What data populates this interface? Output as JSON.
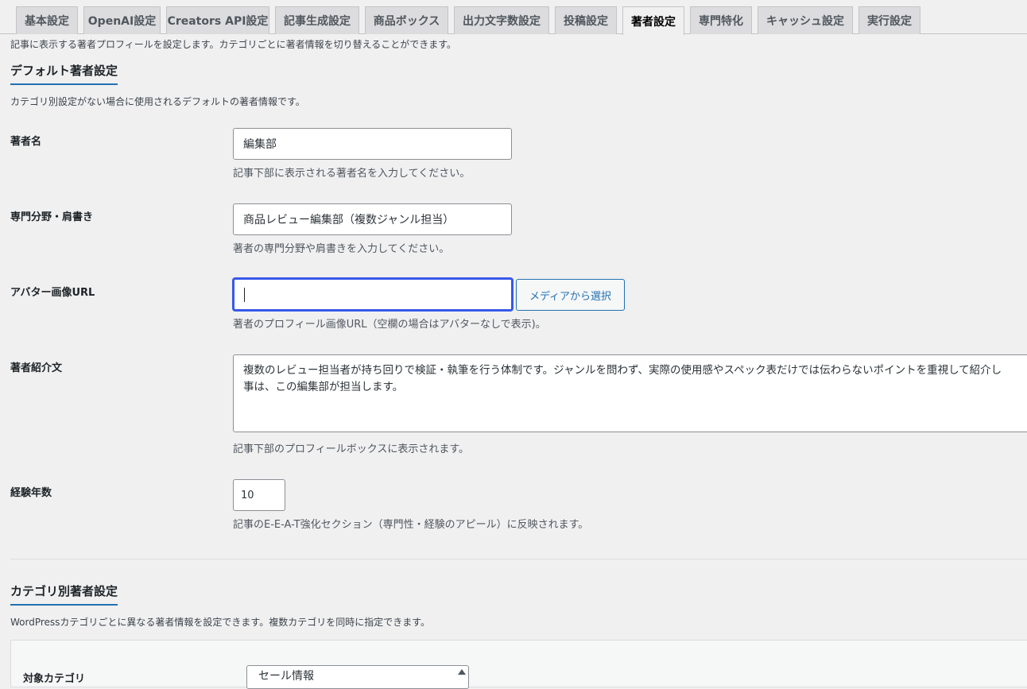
{
  "tabs": [
    {
      "label": "基本設定",
      "active": false
    },
    {
      "label": "OpenAI設定",
      "active": false
    },
    {
      "label": "Creators API設定",
      "active": false
    },
    {
      "label": "記事生成設定",
      "active": false
    },
    {
      "label": "商品ボックス",
      "active": false
    },
    {
      "label": "出力文字数設定",
      "active": false
    },
    {
      "label": "投稿設定",
      "active": false
    },
    {
      "label": "著者設定",
      "active": true
    },
    {
      "label": "専門特化",
      "active": false
    },
    {
      "label": "キャッシュ設定",
      "active": false
    },
    {
      "label": "実行設定",
      "active": false
    }
  ],
  "intro": "記事に表示する著者プロフィールを設定します。カテゴリごとに著者情報を切り替えることができます。",
  "default_section": {
    "title": "デフォルト著者設定",
    "description": "カテゴリ別設定がない場合に使用されるデフォルトの著者情報です。",
    "author_name": {
      "label": "著者名",
      "value": "編集部",
      "help": "記事下部に表示される著者名を入力してください。"
    },
    "specialty": {
      "label": "専門分野・肩書き",
      "value": "商品レビュー編集部（複数ジャンル担当）",
      "help": "著者の専門分野や肩書きを入力してください。"
    },
    "avatar": {
      "label": "アバター画像URL",
      "value": "",
      "button": "メディアから選択",
      "help": "著者のプロフィール画像URL（空欄の場合はアバターなしで表示)。"
    },
    "bio": {
      "label": "著者紹介文",
      "value_line1": "複数のレビュー担当者が持ち回りで検証・執筆を行う体制です。ジャンルを問わず、実際の使用感やスペック表だけでは伝わらないポイントを重視して紹介し",
      "value_line2": "事は、この編集部が担当します。",
      "help": "記事下部のプロフィールボックスに表示されます。"
    },
    "experience": {
      "label": "経験年数",
      "value": "10",
      "help": "記事のE-E-A-T強化セクション（専門性・経験のアピール）に反映されます。"
    }
  },
  "category_section": {
    "title": "カテゴリ別著者設定",
    "description": "WordPressカテゴリごとに異なる著者情報を設定できます。複数カテゴリを同時に指定できます。",
    "target_label": "対象カテゴリ",
    "selected_option": "セール情報"
  }
}
